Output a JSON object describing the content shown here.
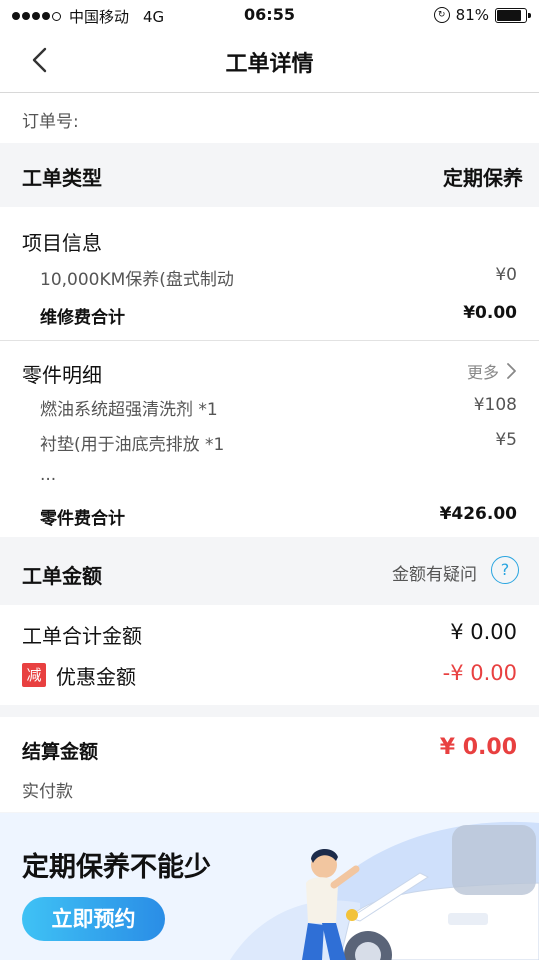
{
  "status_bar": {
    "carrier": "中国移动",
    "network": "4G",
    "time": "06:55",
    "battery": "81%",
    "battery_level": 0.81
  },
  "nav": {
    "title": "工单详情"
  },
  "order": {
    "label": "订单号:"
  },
  "work_type": {
    "label": "工单类型",
    "value": "定期保养"
  },
  "project": {
    "title": "项目信息",
    "items": [
      {
        "name": "10,000KM保养(盘式制动",
        "price": "¥0"
      }
    ],
    "total_label": "维修费合计",
    "total_value": "¥0.00"
  },
  "parts": {
    "title": "零件明细",
    "more_label": "更多",
    "items": [
      {
        "name": "燃油系统超强清洗剂 *1",
        "price": "¥108"
      },
      {
        "name": "衬垫(用于油底壳排放 *1",
        "price": "¥5"
      }
    ],
    "ellipsis": "...",
    "total_label": "零件费合计",
    "total_value": "¥426.00"
  },
  "amount": {
    "title": "工单金额",
    "question": "金额有疑问",
    "help_glyph": "?",
    "total_label": "工单合计金额",
    "total_value": "¥ 0.00",
    "discount_badge": "减",
    "discount_label": "优惠金额",
    "discount_value": "-¥ 0.00"
  },
  "settlement": {
    "label": "结算金额",
    "value": "¥ 0.00",
    "sub": "实付款"
  },
  "banner": {
    "slogan": "定期保养不能少",
    "button": "立即预约"
  },
  "colors": {
    "accent_red": "#e84040",
    "accent_blue": "#2aa5e0",
    "button_start": "#3fc2f5",
    "button_end": "#2a8de6"
  }
}
